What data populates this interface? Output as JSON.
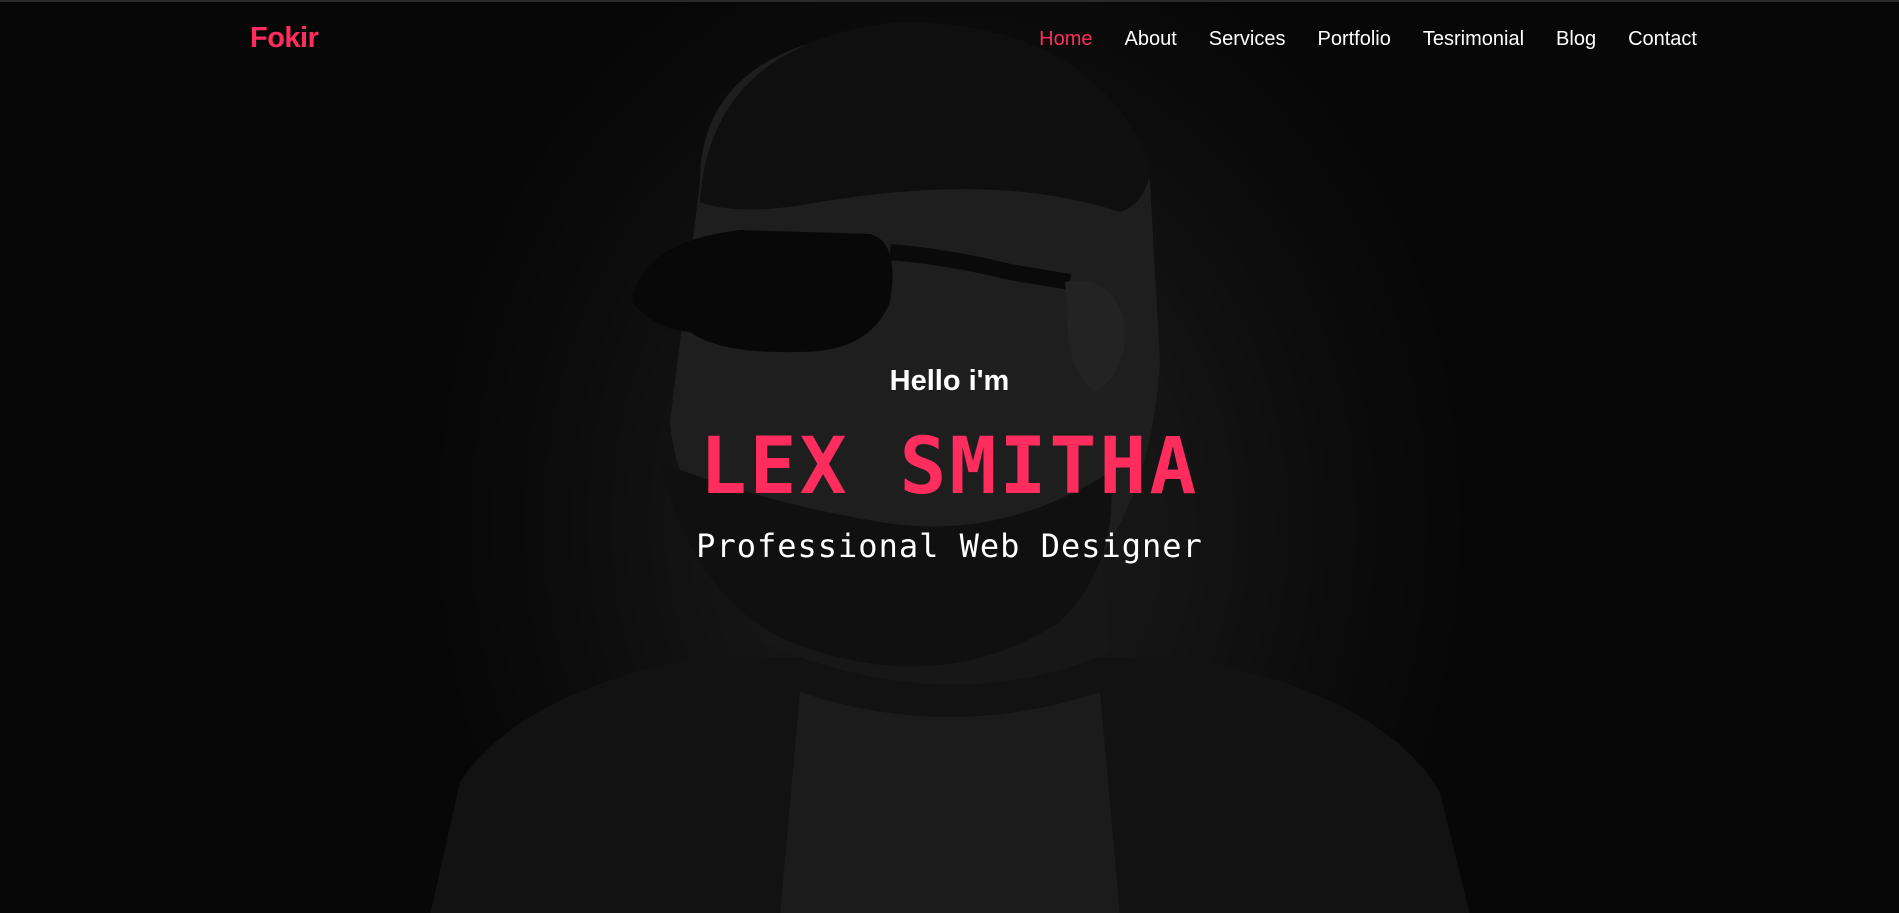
{
  "brand": {
    "logo_text": "Fokir",
    "accent_color": "#ff2d5e"
  },
  "nav": {
    "items": [
      {
        "label": "Home",
        "active": true
      },
      {
        "label": "About"
      },
      {
        "label": "Services"
      },
      {
        "label": "Portfolio"
      },
      {
        "label": "Tesrimonial"
      },
      {
        "label": "Blog"
      },
      {
        "label": "Contact"
      }
    ]
  },
  "hero": {
    "greeting": "Hello i'm",
    "name": "LEX SMITHA",
    "title": "Professional Web Designer"
  },
  "background": {
    "image": "dark-portrait-bearded-man-sunglasses"
  }
}
